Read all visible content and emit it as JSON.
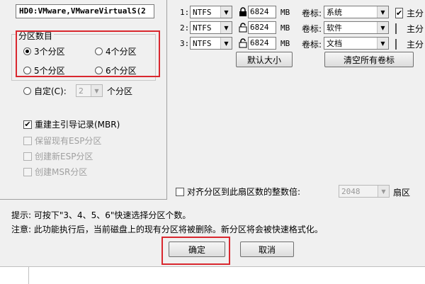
{
  "disk": {
    "name": "HD0:VMware,VMwareVirtualS(2"
  },
  "partition_count_group": {
    "legend": "分区数目",
    "options": [
      {
        "label": "3个分区",
        "selected": true
      },
      {
        "label": "4个分区",
        "selected": false
      },
      {
        "label": "5个分区",
        "selected": false
      },
      {
        "label": "6个分区",
        "selected": false
      }
    ],
    "custom": {
      "label": "自定(C):",
      "value": "2",
      "suffix": "个分区"
    }
  },
  "options": {
    "rebuild_mbr": {
      "label": "重建主引导记录(MBR)",
      "checked": true
    },
    "keep_esp": {
      "label": "保留现有ESP分区",
      "checked": false
    },
    "create_esp": {
      "label": "创建新ESP分区",
      "checked": false
    },
    "create_msr": {
      "label": "创建MSR分区",
      "checked": false
    }
  },
  "partitions": [
    {
      "num": "1:",
      "fs": "NTFS",
      "size": "6824",
      "unit": "MB",
      "label_caption": "卷标:",
      "label": "系统",
      "primary_label": "主分",
      "primary": true
    },
    {
      "num": "2:",
      "fs": "NTFS",
      "size": "6824",
      "unit": "MB",
      "label_caption": "卷标:",
      "label": "软件",
      "primary_label": "主分",
      "primary": false
    },
    {
      "num": "3:",
      "fs": "NTFS",
      "size": "6824",
      "unit": "MB",
      "label_caption": "卷标:",
      "label": "文档",
      "primary_label": "主分",
      "primary": false
    }
  ],
  "buttons": {
    "default_size": "默认大小",
    "clear_labels": "清空所有卷标",
    "ok": "确定",
    "cancel": "取消"
  },
  "align": {
    "label": "对齐分区到此扇区数的整数倍:",
    "value": "2048",
    "unit": "扇区",
    "checked": false
  },
  "hints": {
    "line1": "提示: 可按下\"3、4、5、6\"快速选择分区个数。",
    "line2": "注意: 此功能执行后，当前磁盘上的现有分区将被删除。新分区将会被快速格式化。"
  },
  "colors": {
    "highlight": "#d9272e"
  }
}
